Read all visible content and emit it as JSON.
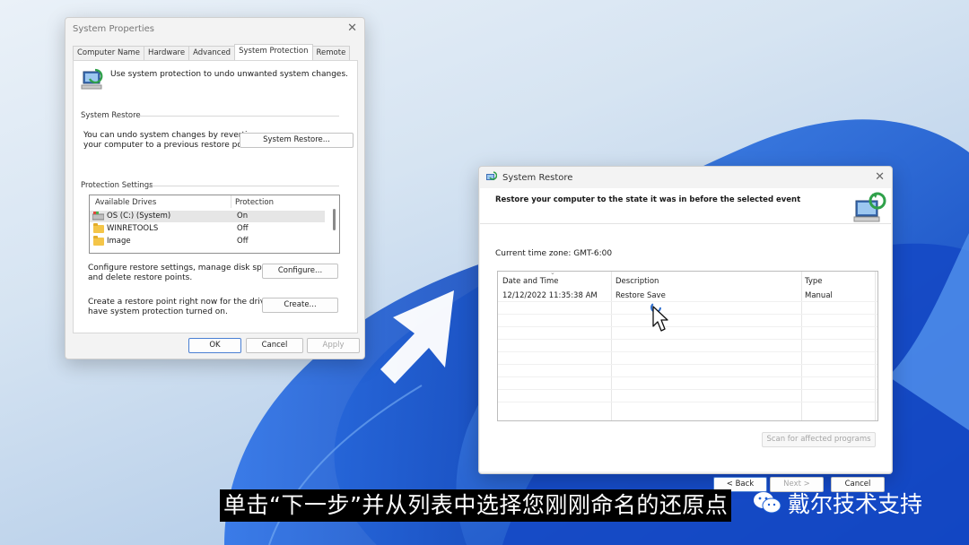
{
  "system_properties": {
    "title": "System Properties",
    "tabs": [
      "Computer Name",
      "Hardware",
      "Advanced",
      "System Protection",
      "Remote"
    ],
    "active_tab": "System Protection",
    "intro_text": "Use system protection to undo unwanted system changes.",
    "system_restore": {
      "heading": "System Restore",
      "description_line1": "You can undo system changes by reverting",
      "description_line2": "your computer to a previous restore point.",
      "button": "System Restore..."
    },
    "protection": {
      "heading": "Protection Settings",
      "columns": [
        "Available Drives",
        "Protection"
      ],
      "drives": [
        {
          "name": "OS (C:) (System)",
          "protection": "On",
          "icon": "system-drive-icon"
        },
        {
          "name": "WINRETOOLS",
          "protection": "Off",
          "icon": "folder-icon"
        },
        {
          "name": "Image",
          "protection": "Off",
          "icon": "folder-icon"
        }
      ],
      "configure_text_line1": "Configure restore settings, manage disk space,",
      "configure_text_line2": "and delete restore points.",
      "configure_button": "Configure...",
      "create_text_line1": "Create a restore point right now for the drives that",
      "create_text_line2": "have system protection turned on.",
      "create_button": "Create..."
    },
    "footer": {
      "ok": "OK",
      "cancel": "Cancel",
      "apply": "Apply"
    }
  },
  "system_restore_dialog": {
    "title": "System Restore",
    "heading": "Restore your computer to the state it was in before the selected event",
    "timezone": "Current time zone: GMT-6:00",
    "columns": [
      "Date and Time",
      "Description",
      "Type"
    ],
    "rows": [
      {
        "date": "12/12/2022 11:35:38 AM",
        "description": "Restore Save",
        "type": "Manual"
      }
    ],
    "scan_button": "Scan for affected programs",
    "back_button": "< Back",
    "next_button": "Next >",
    "cancel_button": "Cancel"
  },
  "caption": "单击“下一步”并从列表中选择您刚刚命名的还原点",
  "brand": "戴尔技术支持",
  "colors": {
    "accent": "#4a7fd3",
    "wallpaper_blue": "#1d5fd6"
  }
}
